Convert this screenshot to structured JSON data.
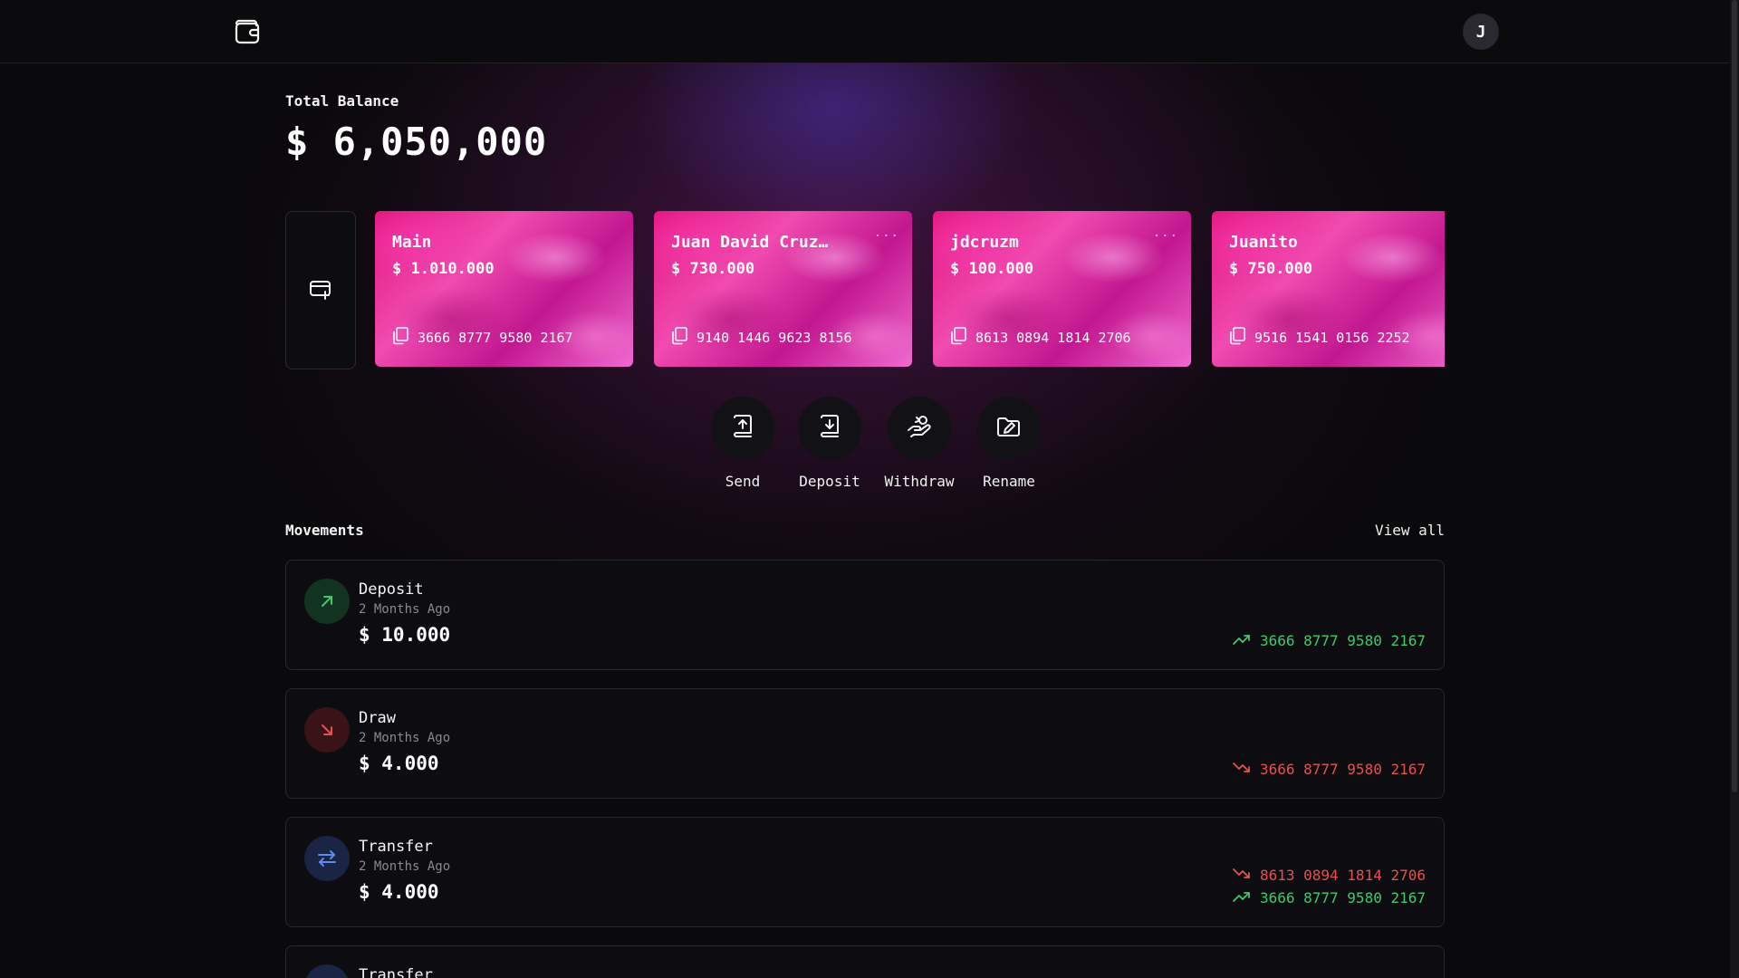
{
  "header": {
    "logo_icon": "wallet-icon",
    "avatar_initial": "J"
  },
  "balance": {
    "label": "Total Balance",
    "value": "$ 6,050,000"
  },
  "cards": [
    {
      "name": "Main",
      "balance": "$ 1.010.000",
      "number": "3666 8777 9580 2167",
      "menu": ""
    },
    {
      "name": "Juan David Cruz…",
      "balance": "$ 730.000",
      "number": "9140 1446 9623 8156",
      "menu": "···"
    },
    {
      "name": "jdcruzm",
      "balance": "$ 100.000",
      "number": "8613 0894 1814 2706",
      "menu": "···"
    },
    {
      "name": "Juanito",
      "balance": "$ 750.000",
      "number": "9516 1541 0156 2252",
      "menu": "···"
    }
  ],
  "actions": [
    {
      "label": "Send",
      "icon": "send-icon"
    },
    {
      "label": "Deposit",
      "icon": "deposit-icon"
    },
    {
      "label": "Withdraw",
      "icon": "withdraw-icon"
    },
    {
      "label": "Rename",
      "icon": "rename-icon"
    }
  ],
  "movements": {
    "title": "Movements",
    "view_all": "View all",
    "items": [
      {
        "type": "Deposit",
        "time": "2 Months Ago",
        "amount": "$ 10.000",
        "accounts": [
          {
            "dir": "up",
            "number": "3666 8777 9580 2167"
          }
        ]
      },
      {
        "type": "Draw",
        "time": "2 Months Ago",
        "amount": "$ 4.000",
        "accounts": [
          {
            "dir": "down",
            "number": "3666 8777 9580 2167"
          }
        ]
      },
      {
        "type": "Transfer",
        "time": "2 Months Ago",
        "amount": "$ 4.000",
        "accounts": [
          {
            "dir": "down",
            "number": "8613 0894 1814 2706"
          },
          {
            "dir": "up",
            "number": "3666 8777 9580 2167"
          }
        ]
      },
      {
        "type": "Transfer",
        "time": "",
        "amount": "",
        "accounts": []
      }
    ]
  },
  "colors": {
    "background": "#0a090c",
    "card_pink": "#e2157d",
    "positive": "#3fc86e",
    "negative": "#e55050"
  }
}
